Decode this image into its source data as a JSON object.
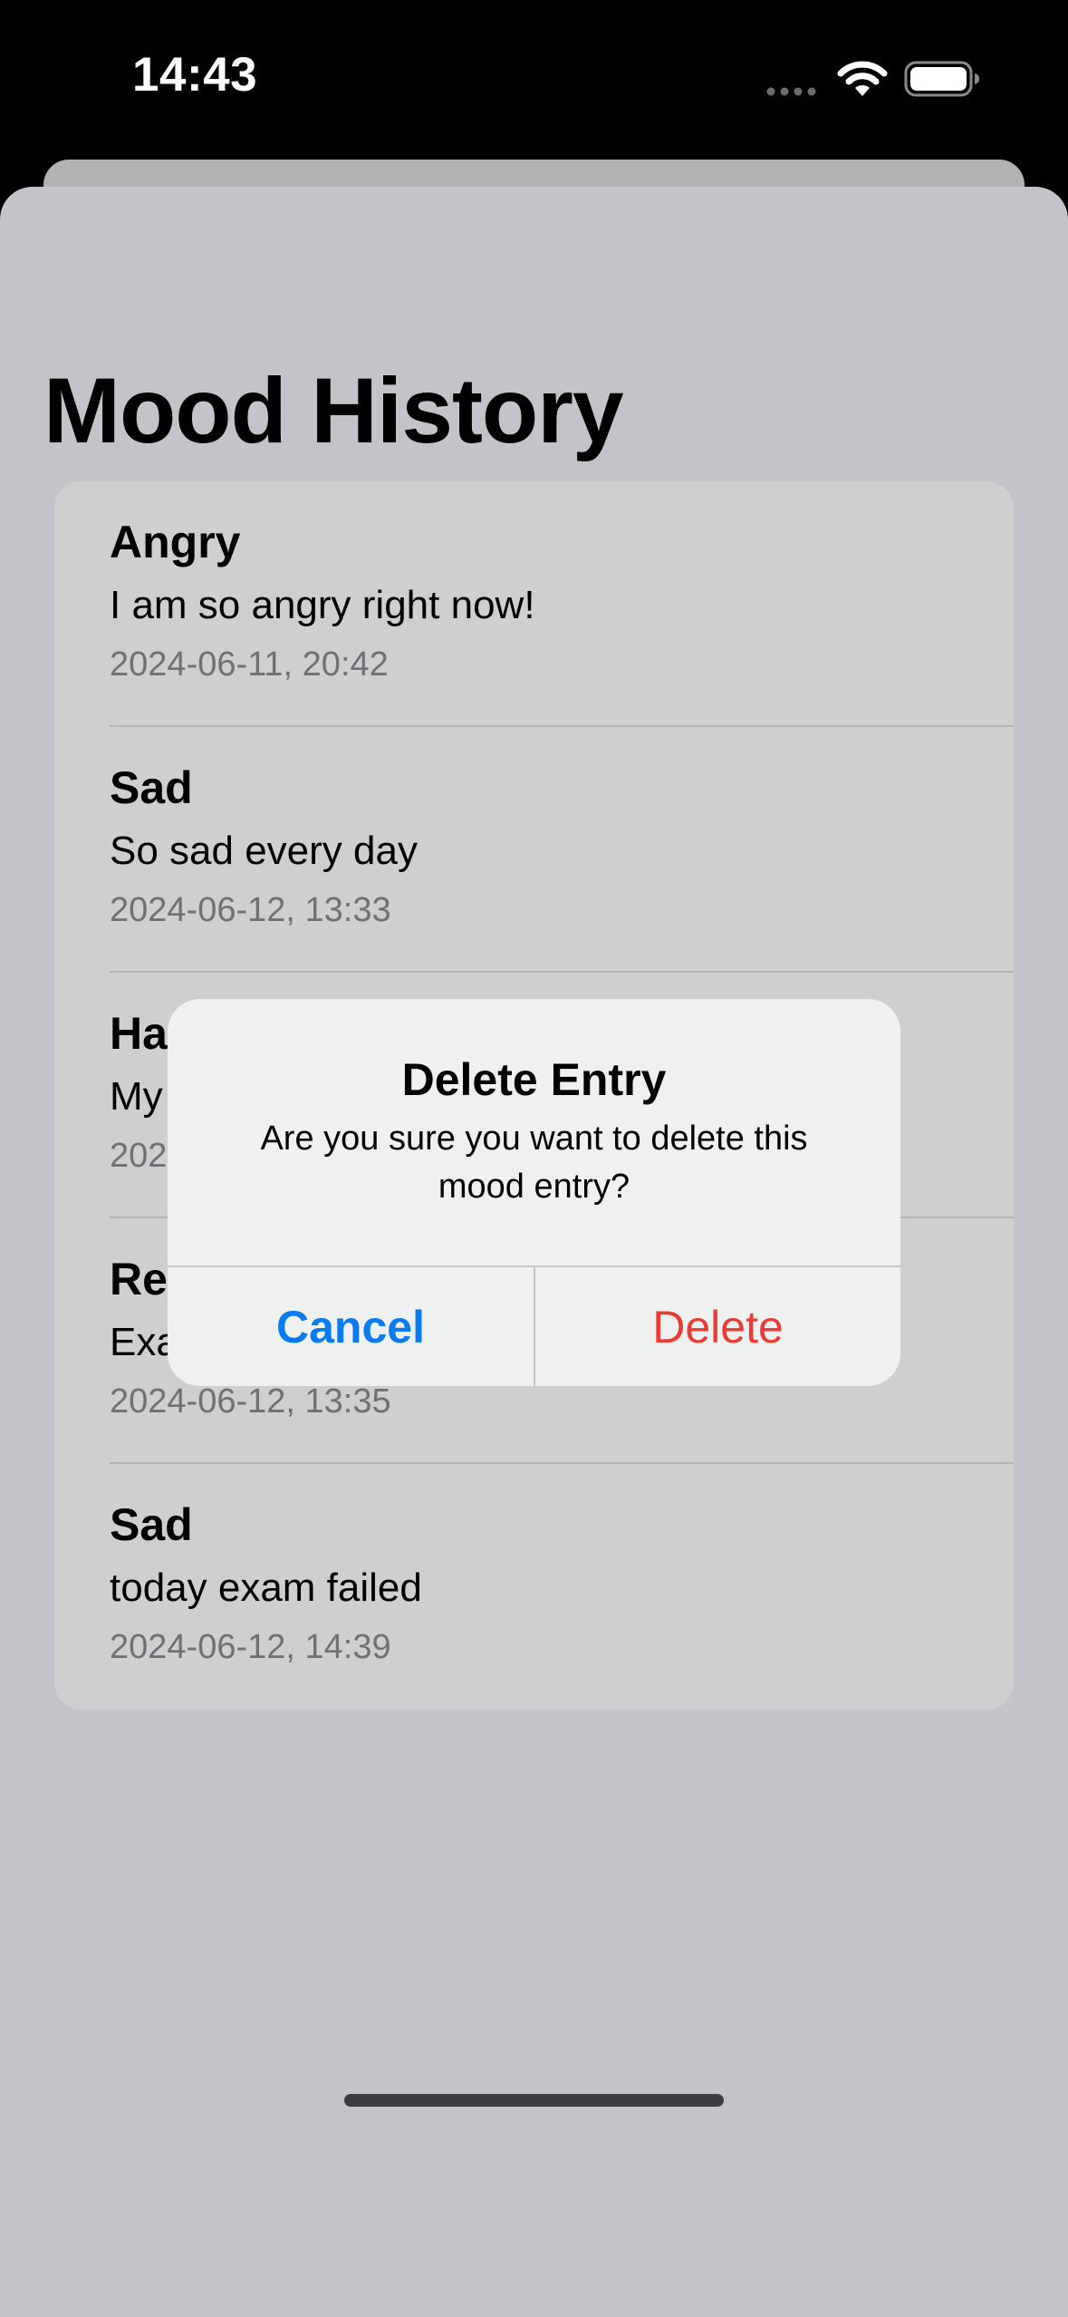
{
  "status_bar": {
    "time": "14:43"
  },
  "page": {
    "title": "Mood History"
  },
  "entries": [
    {
      "mood": "Angry",
      "note": "I am so angry right now!",
      "date": "2024-06-11, 20:42"
    },
    {
      "mood": "Sad",
      "note": "So sad every day",
      "date": "2024-06-12, 13:33"
    },
    {
      "mood": "Ha",
      "note": "My",
      "date": "202"
    },
    {
      "mood": "Re",
      "note": "Exa",
      "date": "2024-06-12, 13:35"
    },
    {
      "mood": "Sad",
      "note": "today exam failed",
      "date": "2024-06-12, 14:39"
    }
  ],
  "alert": {
    "title": "Delete Entry",
    "message": "Are you sure you want to delete this mood entry?",
    "cancel_label": "Cancel",
    "delete_label": "Delete"
  },
  "colors": {
    "cancel": "#0a7bf0",
    "destructive": "#ec3b33",
    "dimmed_background": "#c4c3c9"
  },
  "icons": [
    "wifi-icon",
    "battery-icon",
    "cellular-signal-icon"
  ]
}
